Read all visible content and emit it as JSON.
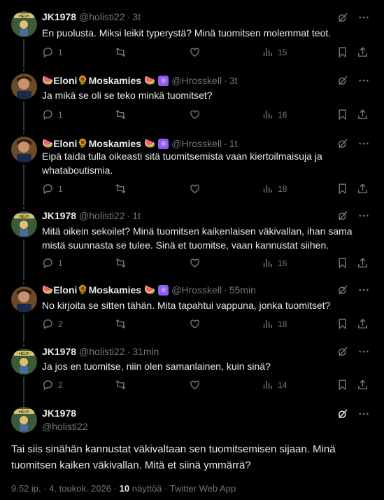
{
  "tweets": [
    {
      "name": "JK1978",
      "handle": "@holisti22",
      "time": "3t",
      "text": "En puolusta. Miksi leikit typerystä? Minä tuomitsen molemmat teot.",
      "replies": "1",
      "likes": "",
      "views": "15",
      "avatar": "jk"
    },
    {
      "name": "Eloni",
      "name2": "Moskamies",
      "handle": "@Hrosskell",
      "time": "3t",
      "text": "Ja mikä se oli se teko minkä tuomitset?",
      "replies": "1",
      "likes": "",
      "views": "16",
      "avatar": "eloni"
    },
    {
      "name": "Eloni",
      "name2": "Moskamies",
      "handle": "@Hrosskell",
      "time": "1t",
      "text": "Eipä taida tulla oikeasti sitä tuomitsemista vaan kiertoilmaisuja ja whataboutismia.",
      "replies": "1",
      "likes": "",
      "views": "18",
      "avatar": "eloni"
    },
    {
      "name": "JK1978",
      "handle": "@holisti22",
      "time": "1t",
      "text": "Mitä oikein sekoilet? Minä tuomitsen kaikenlaisen väkivallan, ihan sama mistä suunnasta se tulee. Sinä et tuomitse, vaan kannustat siihen.",
      "replies": "1",
      "likes": "",
      "views": "16",
      "avatar": "jk"
    },
    {
      "name": "Eloni",
      "name2": "Moskamies",
      "handle": "@Hrosskell",
      "time": "55min",
      "text": "No kirjoita se sitten tähän. Mita tapahtui vappuna, jonka tuomitset?",
      "replies": "2",
      "likes": "",
      "views": "18",
      "avatar": "eloni"
    },
    {
      "name": "JK1978",
      "handle": "@holisti22",
      "time": "31min",
      "text": "Ja jos en tuomitse, niin olen samanlainen, kuin sinä?",
      "replies": "2",
      "likes": "",
      "views": "14",
      "avatar": "jk"
    }
  ],
  "main": {
    "name": "JK1978",
    "handle": "@holisti22",
    "text": "Tai siis sinähän kannustat väkivaltaan sen tuomitsemisen sijaan. Minä tuomitsen kaiken väkivallan. Mitä et siinä ymmärrä?",
    "time": "9.52 ip. · 4. toukok. 2026 ·",
    "views_count": "10",
    "views_label": "näyttöä",
    "source": "· Twitter Web App",
    "avatar_text": "HELP!"
  },
  "emoji": {
    "watermelon": "🍉",
    "sunflower": "🌻",
    "atom": "⚛"
  },
  "separator": "·",
  "colors": {
    "background": "#000000",
    "text": "#e7e9ea",
    "muted": "#71767b",
    "divider": "#2f3336",
    "badge": "#8b5cf6"
  },
  "icons": [
    "reply-icon",
    "retweet-icon",
    "like-icon",
    "views-icon",
    "bookmark-icon",
    "share-icon",
    "grok-icon",
    "more-icon"
  ]
}
